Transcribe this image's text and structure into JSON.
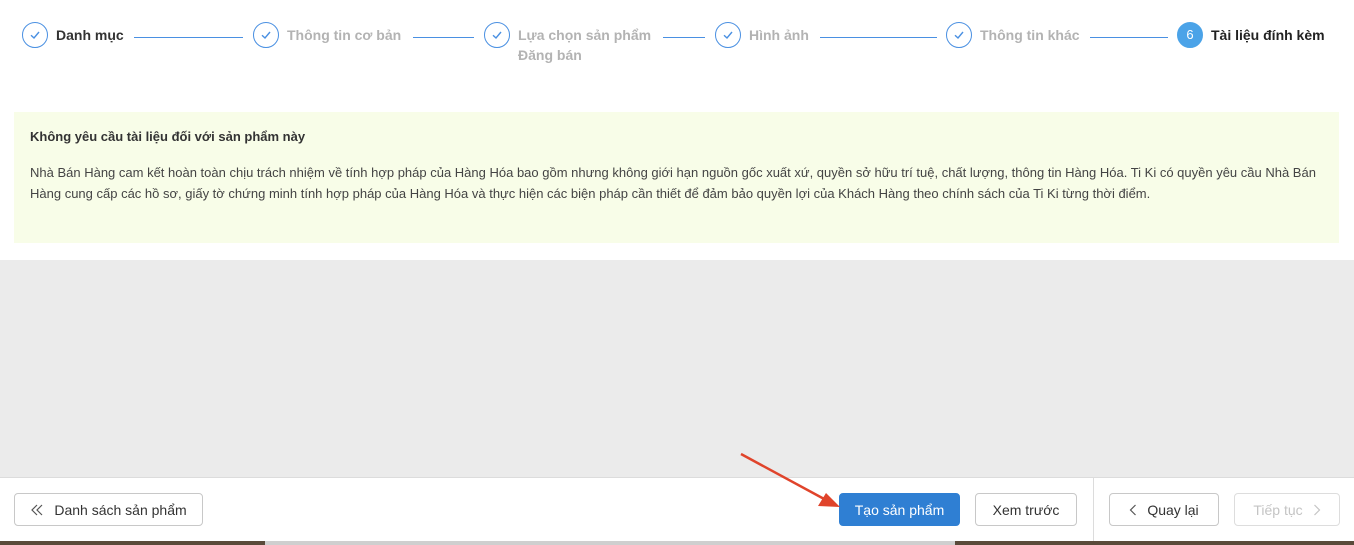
{
  "stepper": {
    "steps": [
      {
        "label": "Danh mục",
        "sub": "",
        "state": "done"
      },
      {
        "label": "Thông tin cơ bản",
        "sub": "",
        "state": "done"
      },
      {
        "label": "Lựa chọn sản phẩm",
        "sub": "Đăng bán",
        "state": "done"
      },
      {
        "label": "Hình ảnh",
        "sub": "",
        "state": "done"
      },
      {
        "label": "Thông tin khác",
        "sub": "",
        "state": "done"
      },
      {
        "label": "Tài liệu đính kèm",
        "sub": "",
        "state": "active",
        "number": "6"
      }
    ],
    "accent_color": "#4a90e2"
  },
  "notice": {
    "title": "Không yêu cầu tài liệu đối với sản phẩm này",
    "body": "Nhà Bán Hàng cam kết hoàn toàn chịu trách nhiệm về tính hợp pháp của Hàng Hóa bao gồm nhưng không giới hạn nguồn gốc xuất xứ, quyền sở hữu trí tuệ, chất lượng, thông tin Hàng Hóa. Ti Ki có quyền yêu cầu Nhà Bán Hàng cung cấp các hồ sơ, giấy tờ chứng minh tính hợp pháp của Hàng Hóa và thực hiện các biện pháp cần thiết để đảm bảo quyền lợi của Khách Hàng theo chính sách của Ti Ki từng thời điểm.",
    "background": "#f8fde8"
  },
  "footer": {
    "product_list_label": "Danh sách sản phẩm",
    "create_label": "Tạo sản phẩm",
    "preview_label": "Xem trước",
    "back_label": "Quay lại",
    "next_label": "Tiếp tục",
    "primary_color": "#2f7fd3"
  },
  "annotation": {
    "arrow_color": "#e0442b"
  }
}
